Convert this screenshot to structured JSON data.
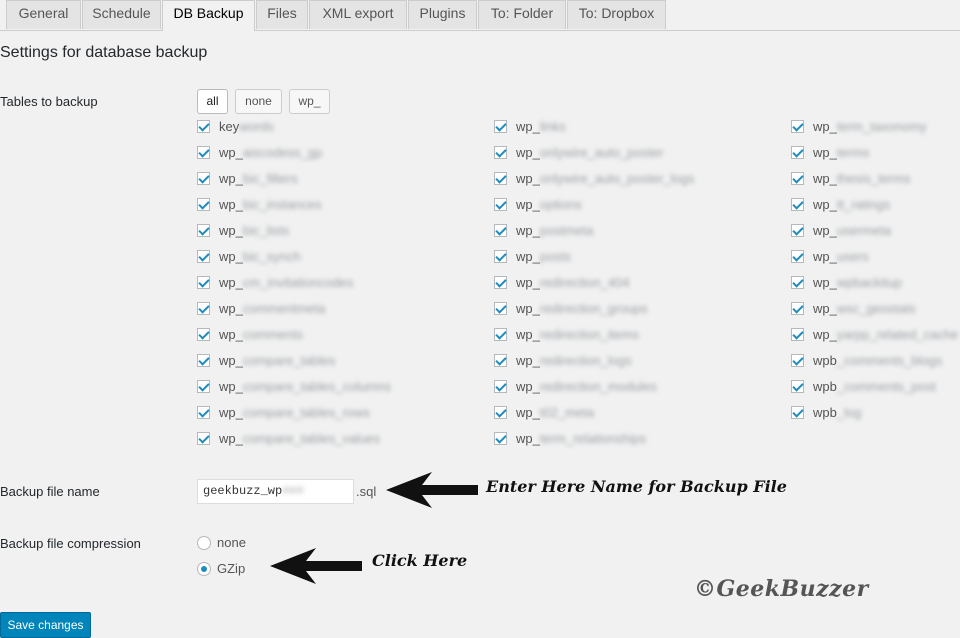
{
  "tabs": [
    "General",
    "Schedule",
    "DB Backup",
    "Files",
    "XML export",
    "Plugins",
    "To: Folder",
    "To: Dropbox"
  ],
  "active_tab": "DB Backup",
  "section_title": "Settings for database backup",
  "tables_label": "Tables to backup",
  "filter_buttons": {
    "all": "all",
    "none": "none",
    "wp": "wp_"
  },
  "tables": [
    [
      {
        "pre": "key",
        "rest": "words"
      },
      {
        "pre": "wp_",
        "rest": "aiscodess_gp"
      },
      {
        "pre": "wp_",
        "rest": "bic_filters"
      },
      {
        "pre": "wp_",
        "rest": "bic_instances"
      },
      {
        "pre": "wp_",
        "rest": "bic_lists"
      },
      {
        "pre": "wp_",
        "rest": "bic_synch"
      },
      {
        "pre": "wp_",
        "rest": "cm_invitationcodes"
      },
      {
        "pre": "wp_",
        "rest": "commentmeta"
      },
      {
        "pre": "wp_",
        "rest": "comments"
      },
      {
        "pre": "wp_",
        "rest": "compare_tables"
      },
      {
        "pre": "wp_",
        "rest": "compare_tables_columns"
      },
      {
        "pre": "wp_",
        "rest": "compare_tables_rows"
      },
      {
        "pre": "wp_",
        "rest": "compare_tables_values"
      }
    ],
    [
      {
        "pre": "wp_",
        "rest": "links"
      },
      {
        "pre": "wp_",
        "rest": "onlywire_auto_poster"
      },
      {
        "pre": "wp_",
        "rest": "onlywire_auto_poster_logs"
      },
      {
        "pre": "wp_",
        "rest": "options"
      },
      {
        "pre": "wp_",
        "rest": "postmeta"
      },
      {
        "pre": "wp_",
        "rest": "posts"
      },
      {
        "pre": "wp_",
        "rest": "redirection_404"
      },
      {
        "pre": "wp_",
        "rest": "redirection_groups"
      },
      {
        "pre": "wp_",
        "rest": "redirection_items"
      },
      {
        "pre": "wp_",
        "rest": "redirection_logs"
      },
      {
        "pre": "wp_",
        "rest": "redirection_modules"
      },
      {
        "pre": "wp_",
        "rest": "t02_meta"
      },
      {
        "pre": "wp_",
        "rest": "term_relationships"
      }
    ],
    [
      {
        "pre": "wp_",
        "rest": "term_taxonomy"
      },
      {
        "pre": "wp_",
        "rest": "terms"
      },
      {
        "pre": "wp_",
        "rest": "thesis_terms"
      },
      {
        "pre": "wp_",
        "rest": "tt_ratings"
      },
      {
        "pre": "wp_",
        "rest": "usermeta"
      },
      {
        "pre": "wp_",
        "rest": "users"
      },
      {
        "pre": "wp_",
        "rest": "wpbackitup"
      },
      {
        "pre": "wp_",
        "rest": "wsc_geostats"
      },
      {
        "pre": "wp_",
        "rest": "yarpp_related_cache"
      },
      {
        "pre": "wpb",
        "rest": "_comments_blogs"
      },
      {
        "pre": "wpb",
        "rest": "_comments_post"
      },
      {
        "pre": "wpb",
        "rest": "_log"
      }
    ]
  ],
  "backup_file_label": "Backup file name",
  "backup_file_value": "geekbuzz_wp",
  "backup_file_value_hidden": "###",
  "backup_file_suffix": ".sql",
  "compression_label": "Backup file compression",
  "compression_options": [
    "none",
    "GZip"
  ],
  "compression_selected": "GZip",
  "annotations": {
    "file_name": "Enter Here Name for Backup File",
    "compression": "Click Here"
  },
  "watermark": "©GeekBuzzer",
  "save_button": "Save changes",
  "colors": {
    "accent": "#0085ba",
    "checkbox": "#1e8cbe",
    "background": "#f1f1f1"
  }
}
